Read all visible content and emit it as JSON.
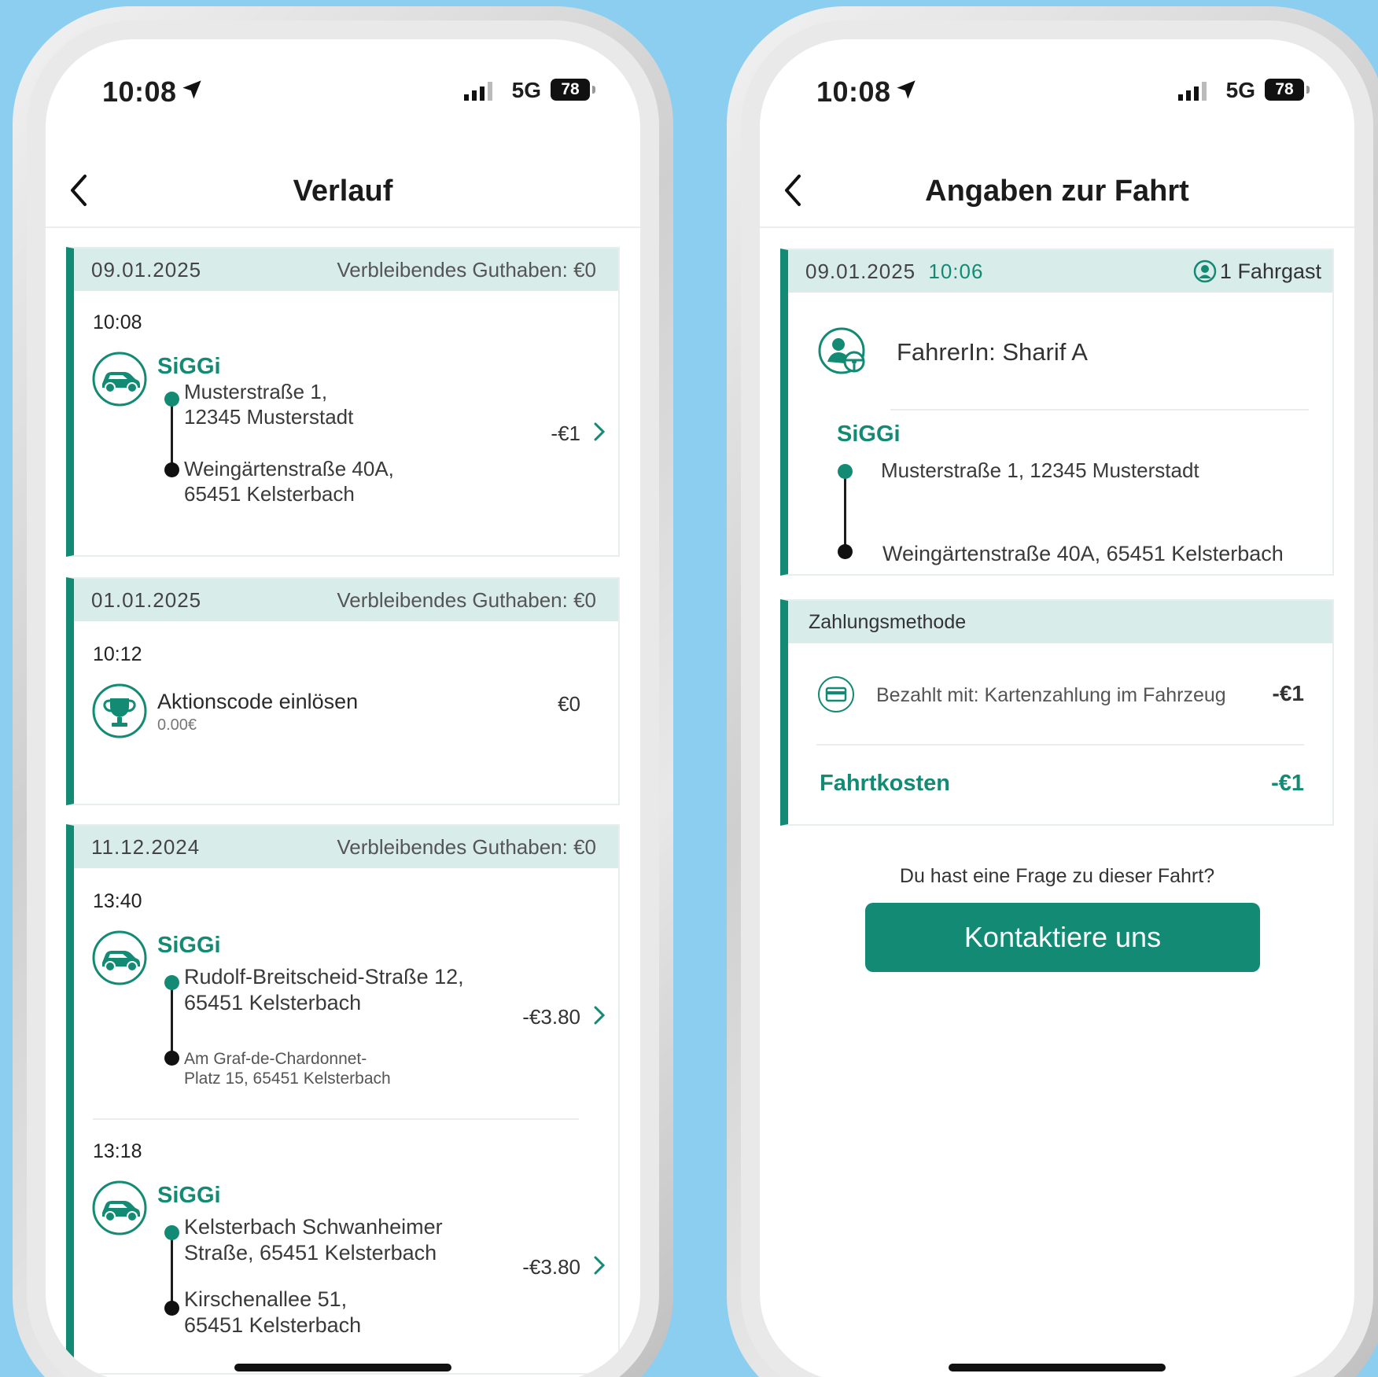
{
  "colors": {
    "accent": "#138a73",
    "header_bg": "#d8ecea",
    "background": "#8ccef0"
  },
  "status_bar": {
    "time": "10:08",
    "network": "5G",
    "battery": "78"
  },
  "left": {
    "title": "Verlauf",
    "cards": [
      {
        "date": "09.01.2025",
        "balance_label": "Verbleibendes Guthaben: €0",
        "entries": [
          {
            "time": "10:08",
            "type": "ride",
            "service": "SiGGi",
            "from": [
              "Musterstraße 1,",
              "12345 Musterstadt"
            ],
            "to": [
              "Weingärtenstraße 40A,",
              "65451 Kelsterbach"
            ],
            "price": "-€1"
          }
        ]
      },
      {
        "date": "01.01.2025",
        "balance_label": "Verbleibendes Guthaben: €0",
        "entries": [
          {
            "time": "10:12",
            "type": "promo",
            "title": "Aktionscode einlösen",
            "subtitle": "0.00€",
            "price": "€0"
          }
        ]
      },
      {
        "date": "11.12.2024",
        "balance_label": "Verbleibendes Guthaben: €0",
        "entries": [
          {
            "time": "13:40",
            "type": "ride",
            "service": "SiGGi",
            "from": [
              "Rudolf-Breitscheid-Straße 12,",
              "65451 Kelsterbach"
            ],
            "to": [
              "Am Graf-de-Chardonnet-",
              "Platz 15, 65451 Kelsterbach"
            ],
            "price": "-€3.80"
          },
          {
            "time": "13:18",
            "type": "ride",
            "service": "SiGGi",
            "from": [
              "Kelsterbach Schwanheimer",
              "Straße, 65451 Kelsterbach"
            ],
            "to": [
              "Kirschenallee 51,",
              "65451 Kelsterbach"
            ],
            "price": "-€3.80"
          }
        ]
      }
    ]
  },
  "right": {
    "title": "Angaben zur Fahrt",
    "ride_card": {
      "date": "09.01.2025",
      "time": "10:06",
      "passengers": "1 Fahrgast",
      "driver": "FahrerIn: Sharif A",
      "service": "SiGGi",
      "from": "Musterstraße 1, 12345 Musterstadt",
      "to": "Weingärtenstraße 40A, 65451 Kelsterbach"
    },
    "payment_card": {
      "title": "Zahlungsmethode",
      "method": "Bezahlt mit: Kartenzahlung im Fahrzeug",
      "method_amount": "-€1",
      "total_label": "Fahrtkosten",
      "total_amount": "-€1"
    },
    "question": "Du hast eine Frage zu dieser Fahrt?",
    "contact_button": "Kontaktiere uns"
  }
}
